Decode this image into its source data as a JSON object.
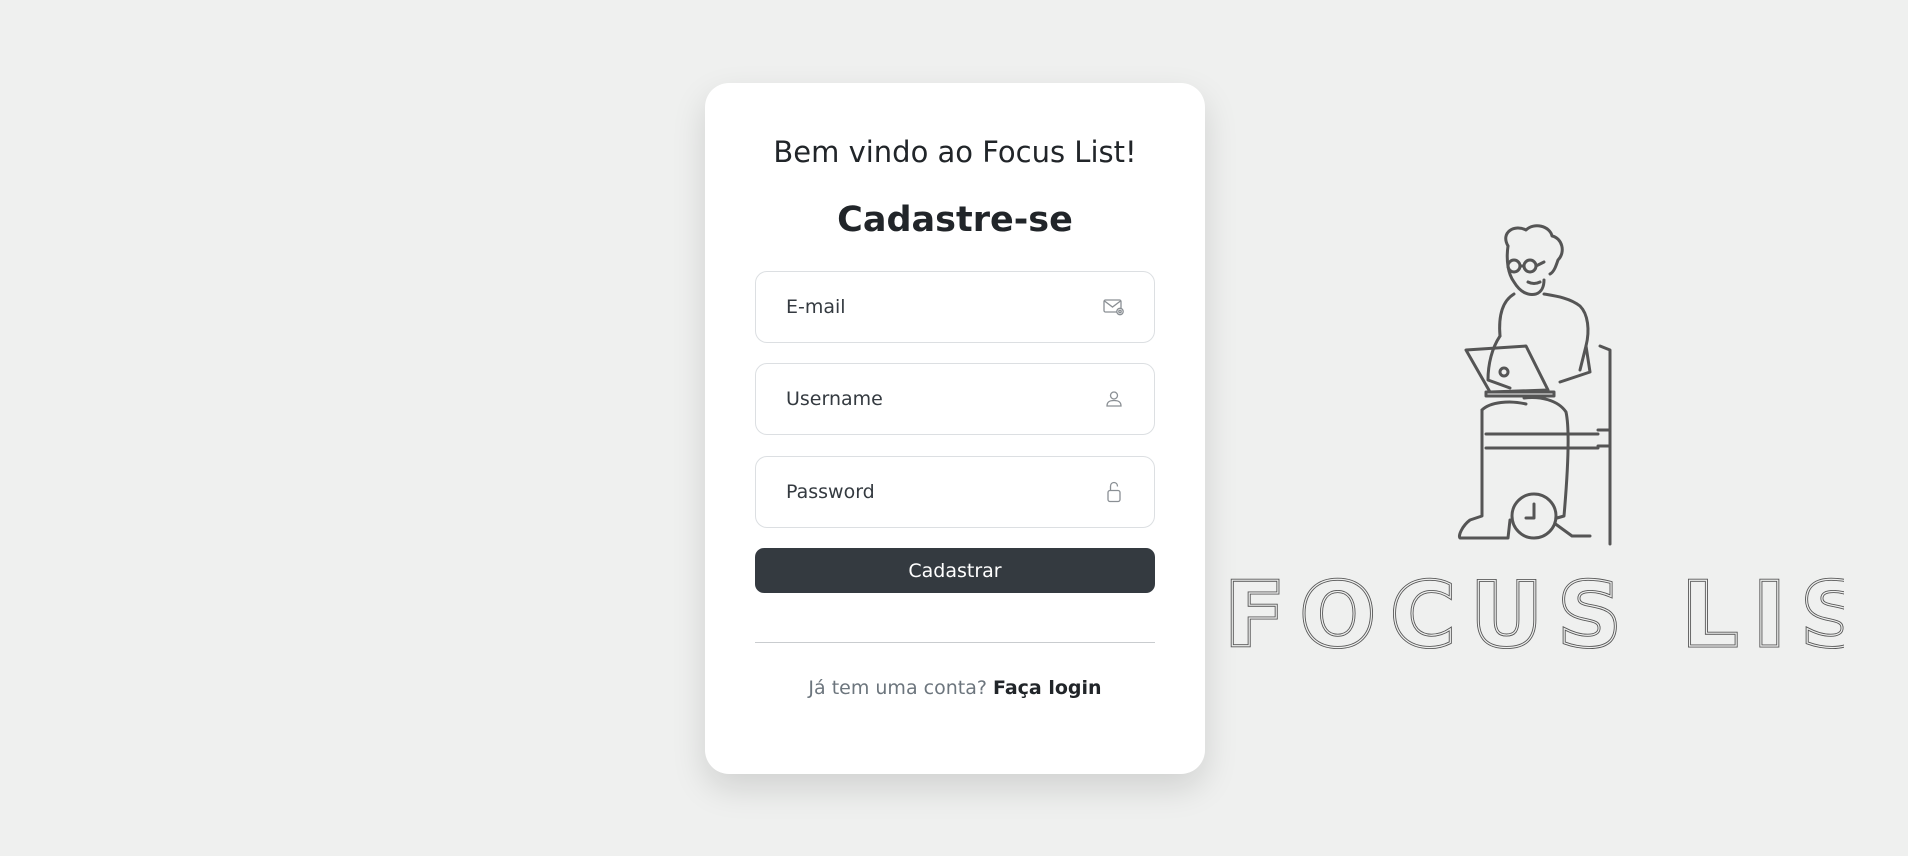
{
  "card": {
    "welcome": "Bem vindo ao Focus List!",
    "title": "Cadastre-se",
    "email": {
      "placeholder": "E-mail",
      "value": ""
    },
    "username": {
      "placeholder": "Username",
      "value": ""
    },
    "password": {
      "placeholder": "Password",
      "value": ""
    },
    "submit_label": "Cadastrar",
    "login_prompt": "Já tem uma conta?",
    "login_link": "Faça login"
  },
  "brand": {
    "logo_text": "FOCUS LIST"
  },
  "icons": {
    "email": "envelope-icon",
    "username": "person-icon",
    "password": "lock-icon"
  },
  "colors": {
    "background": "#eff0ef",
    "card": "#ffffff",
    "button": "#343a40",
    "logo": "#555555"
  }
}
